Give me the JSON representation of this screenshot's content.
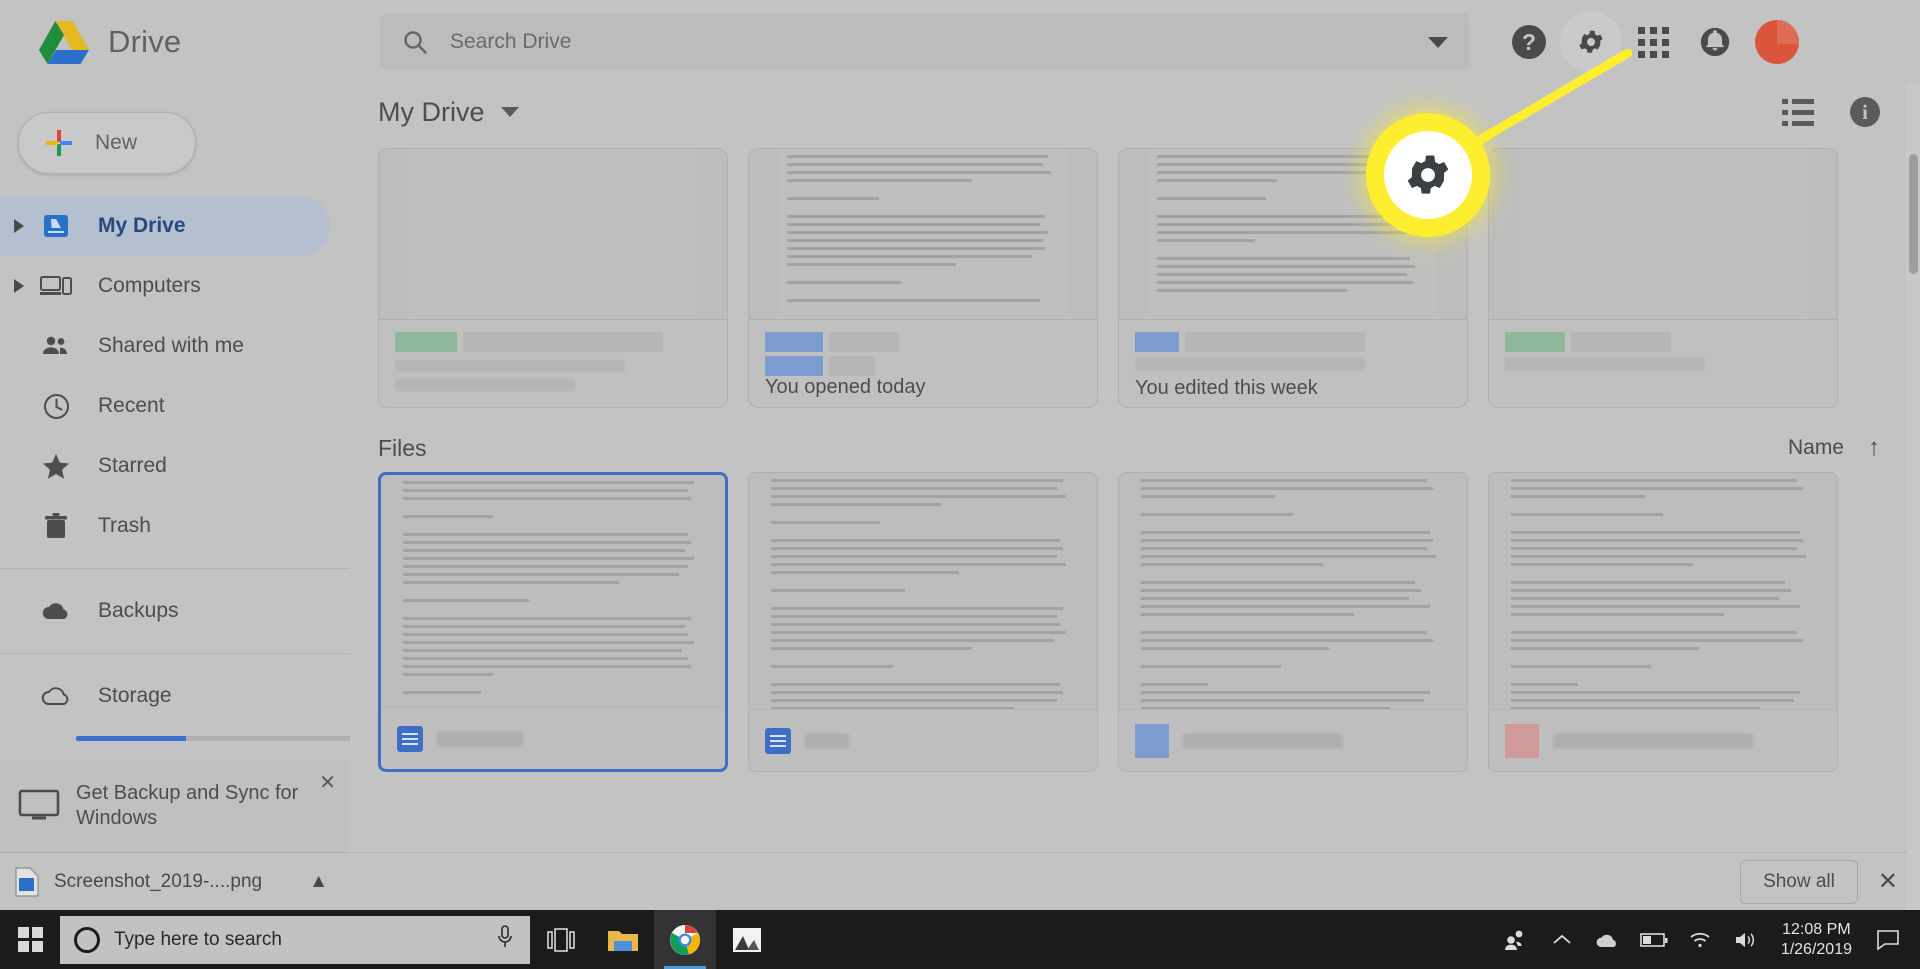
{
  "app": {
    "brand_name": "Drive",
    "logo_icon": "google-drive-logo"
  },
  "search": {
    "placeholder": "Search Drive",
    "value": "",
    "icon": "search-icon",
    "dropdown_icon": "chevron-down-icon"
  },
  "topbar_icons": {
    "help": "?",
    "help_name": "help-icon",
    "settings_name": "gear-icon",
    "apps_name": "apps-grid-icon",
    "notifications_name": "bell-icon",
    "avatar_name": "user-avatar"
  },
  "sidebar": {
    "new_button": "New",
    "items": [
      {
        "label": "My Drive",
        "icon": "drive-icon",
        "expandable": true,
        "active": true
      },
      {
        "label": "Computers",
        "icon": "computer-icon",
        "expandable": true,
        "active": false
      },
      {
        "label": "Shared with me",
        "icon": "people-icon",
        "expandable": false,
        "active": false
      },
      {
        "label": "Recent",
        "icon": "clock-icon",
        "expandable": false,
        "active": false
      },
      {
        "label": "Starred",
        "icon": "star-icon",
        "expandable": false,
        "active": false
      },
      {
        "label": "Trash",
        "icon": "trash-icon",
        "expandable": false,
        "active": false
      }
    ],
    "backups": {
      "label": "Backups",
      "icon": "cloud-filled-icon"
    },
    "storage": {
      "label": "Storage",
      "icon": "cloud-outline-icon",
      "used_percent": 38
    },
    "promo": {
      "text": "Get Backup and Sync for Windows",
      "icon": "monitor-icon",
      "close_icon": "close-icon"
    }
  },
  "download_bar": {
    "file_name": "Screenshot_2019-....png",
    "file_icon": "png-file-icon",
    "chevron": "chevron-up-icon",
    "show_all": "Show all",
    "close_icon": "close-icon"
  },
  "main": {
    "breadcrumb_title": "My Drive",
    "breadcrumb_caret": "chevron-down-icon",
    "list_view_icon": "list-view-icon",
    "details_icon": "info-icon",
    "quick_access": [
      {
        "caption": "",
        "swatch_color": "#8fb79a"
      },
      {
        "caption": "You opened today",
        "swatch_color": "#7d9cd0"
      },
      {
        "caption": "You edited this week",
        "swatch_color": "#7d9cd0"
      },
      {
        "caption": "",
        "swatch_color": "#8fb79a"
      }
    ],
    "files_section_title": "Files",
    "sort": {
      "label": "Name",
      "direction_icon": "arrow-up-icon"
    },
    "files": [
      {
        "selected": true,
        "icon": "google-docs-icon",
        "accent": "#3f6fc4"
      },
      {
        "selected": false,
        "icon": "google-docs-icon",
        "accent": "#3f6fc4"
      },
      {
        "selected": false,
        "icon": "google-docs-icon",
        "accent": "#7d9cd0"
      },
      {
        "selected": false,
        "icon": "google-docs-icon",
        "accent": "#d19a9a"
      }
    ]
  },
  "highlight": {
    "target": "gear-icon",
    "color": "#fdee2f"
  },
  "taskbar": {
    "start_icon": "windows-start-icon",
    "search_placeholder": "Type here to search",
    "cortana_icon": "cortana-icon",
    "mic_icon": "microphone-icon",
    "taskview_icon": "task-view-icon",
    "apps": [
      {
        "name": "file-explorer-icon",
        "active": false
      },
      {
        "name": "chrome-icon",
        "active": true
      },
      {
        "name": "photos-icon",
        "active": false
      }
    ],
    "tray": [
      {
        "name": "people-tray-icon"
      },
      {
        "name": "show-hidden-icons-icon"
      },
      {
        "name": "onedrive-icon"
      },
      {
        "name": "battery-icon"
      },
      {
        "name": "wifi-icon"
      },
      {
        "name": "volume-icon"
      }
    ],
    "time": "12:08 PM",
    "date": "1/26/2019",
    "action_center_icon": "action-center-icon"
  }
}
